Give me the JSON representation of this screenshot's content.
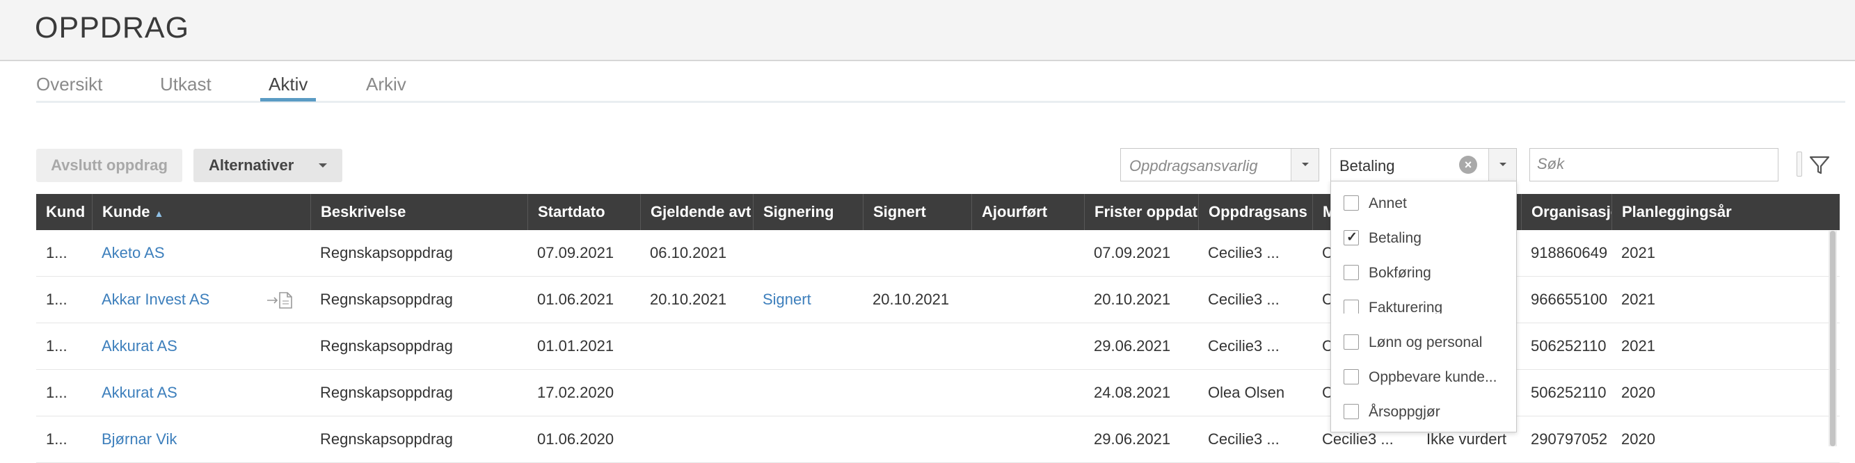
{
  "header": {
    "title": "OPPDRAG"
  },
  "tabs": [
    {
      "label": "Oversikt"
    },
    {
      "label": "Utkast"
    },
    {
      "label": "Aktiv"
    },
    {
      "label": "Arkiv"
    }
  ],
  "toolbar": {
    "close_label": "Avslutt oppdrag",
    "alternatives_label": "Alternativer",
    "responsible_placeholder": "Oppdragsansvarlig",
    "category_value": "Betaling",
    "search_placeholder": "Søk"
  },
  "columns": [
    "Kund",
    "Kunde",
    "Beskrivelse",
    "Startdato",
    "Gjeldende avt",
    "Signering",
    "Signert",
    "Ajourført",
    "Frister oppdat",
    "Oppdragsans",
    "M",
    "",
    "Organisasjons",
    "Planleggingsår"
  ],
  "rows": [
    {
      "nr": "1...",
      "kunde": "Aketo AS",
      "beskrivelse": "Regnskapsoppdrag",
      "startdato": "07.09.2021",
      "gjeldende": "06.10.2021",
      "signering": "",
      "signert": "",
      "ajour": "",
      "frister": "07.09.2021",
      "ansvarlig": "Cecilie3 ...",
      "m": "C",
      "col12": "",
      "org": "918860649",
      "aar": "2021"
    },
    {
      "nr": "1...",
      "kunde": "Akkar Invest AS",
      "beskrivelse": "Regnskapsoppdrag",
      "startdato": "01.06.2021",
      "gjeldende": "20.10.2021",
      "signering": "Signert",
      "signert": "20.10.2021",
      "ajour": "",
      "frister": "20.10.2021",
      "ansvarlig": "Cecilie3 ...",
      "m": "C",
      "col12": "",
      "org": "966655100",
      "aar": "2021"
    },
    {
      "nr": "1...",
      "kunde": "Akkurat AS",
      "beskrivelse": "Regnskapsoppdrag",
      "startdato": "01.01.2021",
      "gjeldende": "",
      "signering": "",
      "signert": "",
      "ajour": "",
      "frister": "29.06.2021",
      "ansvarlig": "Cecilie3 ...",
      "m": "C",
      "col12": "",
      "org": "506252110",
      "aar": "2021"
    },
    {
      "nr": "1...",
      "kunde": "Akkurat AS",
      "beskrivelse": "Regnskapsoppdrag",
      "startdato": "17.02.2020",
      "gjeldende": "",
      "signering": "",
      "signert": "",
      "ajour": "",
      "frister": "24.08.2021",
      "ansvarlig": "Olea Olsen",
      "m": "C",
      "col12": "",
      "org": "506252110",
      "aar": "2020"
    },
    {
      "nr": "1...",
      "kunde": "Bjørnar Vik",
      "beskrivelse": "Regnskapsoppdrag",
      "startdato": "01.06.2020",
      "gjeldende": "",
      "signering": "",
      "signert": "",
      "ajour": "",
      "frister": "29.06.2021",
      "ansvarlig": "Cecilie3 ...",
      "m": "Cecilie3 ...",
      "col12": "Ikke vurdert",
      "org": "290797052",
      "aar": "2020"
    }
  ],
  "dropdown_options": [
    {
      "label": "Annet",
      "checked": false
    },
    {
      "label": "Betaling",
      "checked": true
    },
    {
      "label": "Bokføring",
      "checked": false
    },
    {
      "label": "Fakturering",
      "checked": false
    },
    {
      "label": "Lønn og personal",
      "checked": false
    },
    {
      "label": "Oppbevare kunde...",
      "checked": false
    },
    {
      "label": "Årsoppgjør",
      "checked": false
    }
  ],
  "colors": {
    "accent": "#5a9bc4",
    "link": "#3d7fbc",
    "header_bg": "#3d3d3d"
  }
}
